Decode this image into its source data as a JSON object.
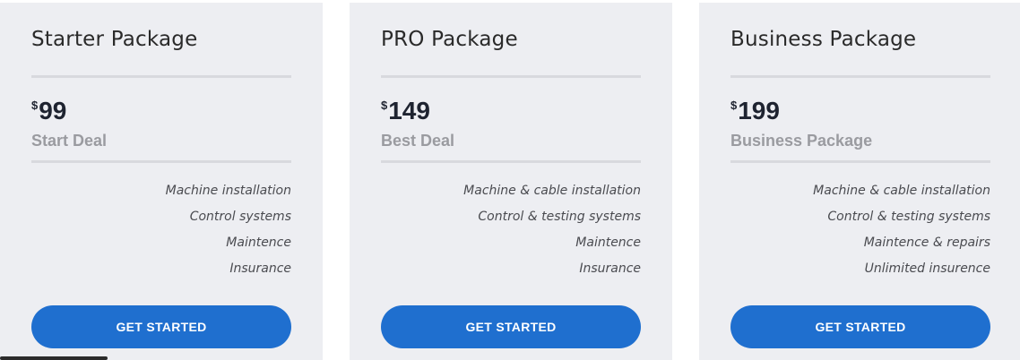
{
  "packages": [
    {
      "title": "Starter Package",
      "currency": "$",
      "price": "99",
      "deal": "Start Deal",
      "features": [
        "Machine installation",
        "Control systems",
        "Maintence",
        "Insurance"
      ],
      "button_label": "GET STARTED"
    },
    {
      "title": "PRO Package",
      "currency": "$",
      "price": "149",
      "deal": "Best Deal",
      "features": [
        "Machine & cable installation",
        "Control & testing systems",
        "Maintence",
        "Insurance"
      ],
      "button_label": "GET STARTED"
    },
    {
      "title": "Business Package",
      "currency": "$",
      "price": "199",
      "deal": "Business Package",
      "features": [
        "Machine & cable installation",
        "Control & testing systems",
        "Maintence & repairs",
        "Unlimited insurence"
      ],
      "button_label": "GET STARTED"
    }
  ],
  "colors": {
    "card_background": "#edeef2",
    "button": "#1f6fcf",
    "deal_text": "#9a9ba0"
  }
}
